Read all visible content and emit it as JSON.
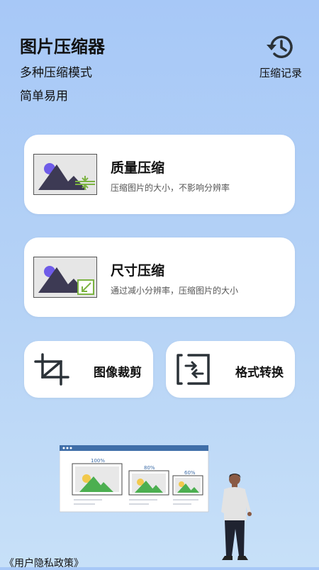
{
  "header": {
    "title": "图片压缩器",
    "subtitle_1": "多种压缩模式",
    "subtitle_2": "简单易用",
    "history_label": "压缩记录",
    "history_icon": "history-icon"
  },
  "cards": {
    "quality": {
      "title": "质量压缩",
      "desc": "压缩图片的大小，不影响分辨率"
    },
    "size": {
      "title": "尺寸压缩",
      "desc": "通过减小分辨率，压缩图片的大小"
    },
    "crop": {
      "label": "图像裁剪",
      "icon": "crop-icon"
    },
    "convert": {
      "label": "格式转换",
      "icon": "format-convert-icon"
    }
  },
  "illustration": {
    "pct_1": "100%",
    "pct_2": "80%",
    "pct_3": "60%"
  },
  "footer": {
    "privacy": "《用户隐私政策》"
  },
  "colors": {
    "accent_green": "#7cb342",
    "mountain_dark": "#3d3a54",
    "sun_purple": "#6f5ce8",
    "icon_dark": "#2b3238"
  }
}
